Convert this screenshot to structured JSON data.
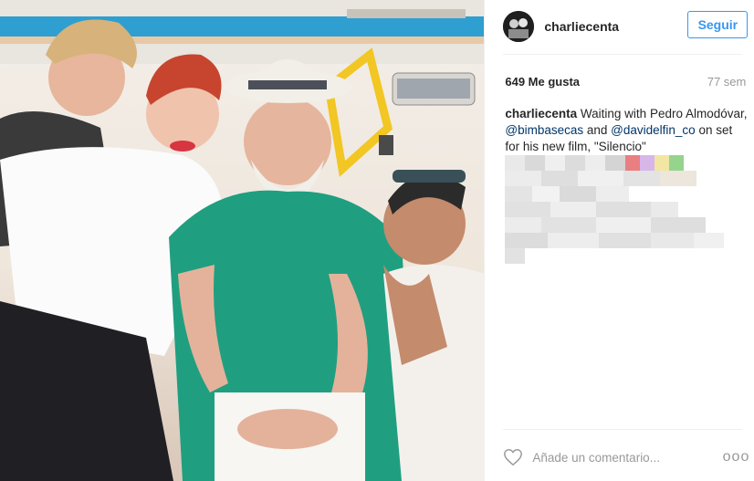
{
  "post": {
    "username": "charliecenta",
    "follow_label": "Seguir",
    "likes": "649 Me gusta",
    "age": "77 sem",
    "caption": {
      "author": "charliecenta",
      "text_1": "Waiting with Pedro Almodóvar,",
      "mention_1": "@bimbasecas",
      "text_2": "and",
      "mention_2": "@davidelfin_co",
      "text_3": "on set for his new film, \"Silencio\""
    },
    "comment_placeholder": "Añade un comentario...",
    "more_label": "ooo"
  },
  "icons": {
    "like": "heart-icon",
    "more": "more-options-icon"
  },
  "colors": {
    "link": "#003569",
    "follow": "#3897f0",
    "muted": "#999999"
  }
}
